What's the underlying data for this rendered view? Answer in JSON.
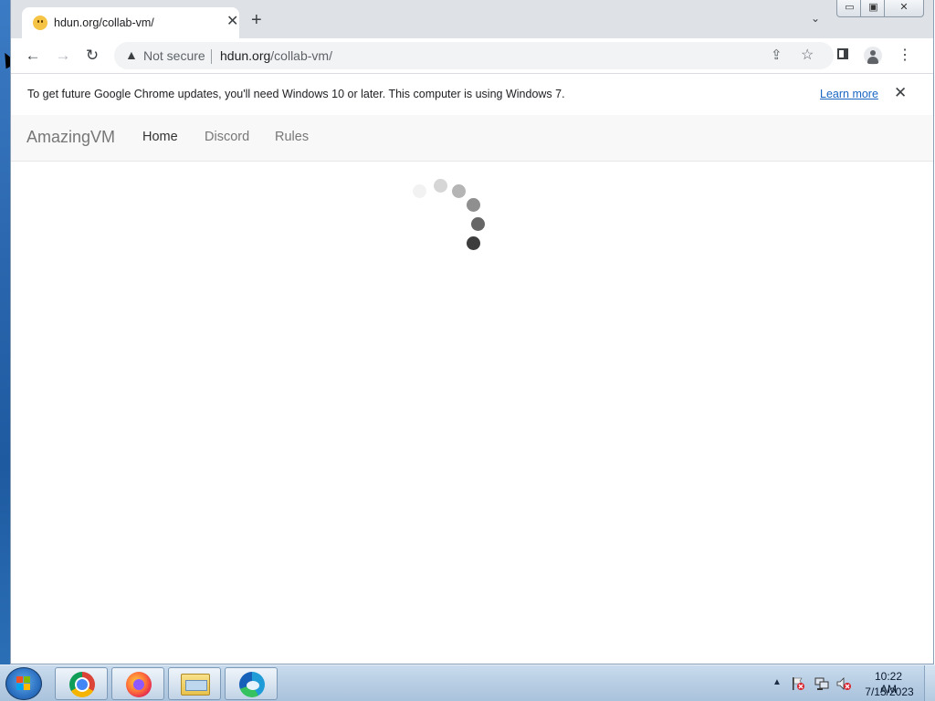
{
  "browser": {
    "tab_title": "hdun.org/collab-vm/",
    "tab_close": "✕",
    "new_tab": "+",
    "tab_search": "⌄",
    "not_secure": "Not secure",
    "url_host": "hdun.org",
    "url_path": "/collab-vm/",
    "window_controls": {
      "minimize": "▭",
      "maximize": "▣",
      "close": "✕"
    }
  },
  "infobar": {
    "message": "To get future Google Chrome updates, you'll need Windows 10 or later. This computer is using Windows 7.",
    "learn_more": "Learn more",
    "close": "✕"
  },
  "site": {
    "brand": "AmazingVM",
    "nav": [
      "Home",
      "Discord",
      "Rules"
    ]
  },
  "taskbar": {
    "apps": [
      "chrome-icon",
      "firefox-icon",
      "file-explorer-icon",
      "edge-icon"
    ],
    "tray_expand": "▲",
    "time": "10:22 AM",
    "date": "7/15/2023"
  },
  "colors": {
    "link": "#1a66c2",
    "navbar_bg": "#f8f8f8",
    "spinner_dots": [
      "#f2f2f2",
      "#d6d6d6",
      "#b5b5b5",
      "#8f8f8f",
      "#666666",
      "#3d3d3d"
    ]
  }
}
